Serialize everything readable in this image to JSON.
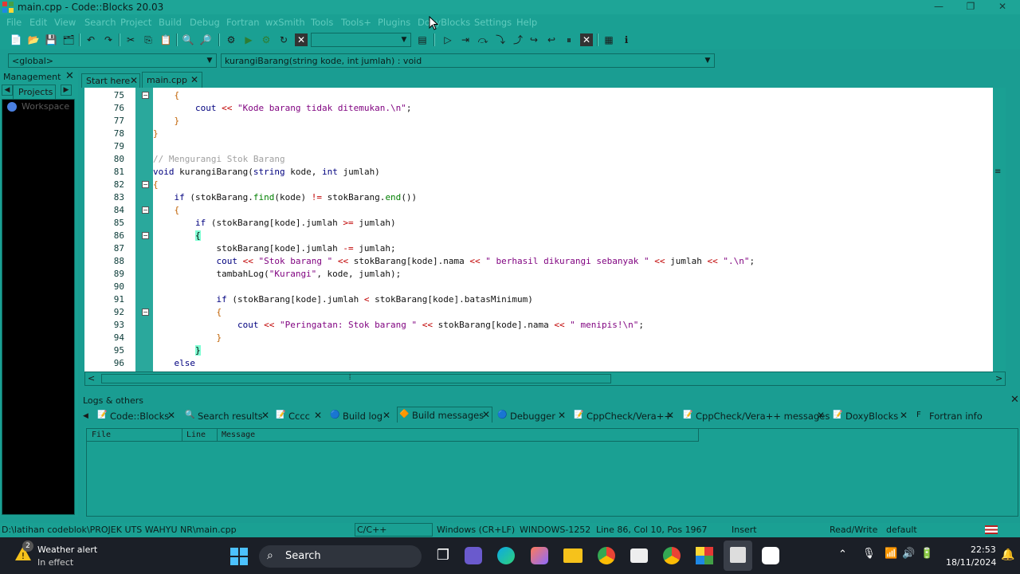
{
  "window": {
    "title": "main.cpp - Code::Blocks 20.03"
  },
  "menu": [
    "File",
    "Edit",
    "View",
    "Search",
    "Project",
    "Build",
    "Debug",
    "Fortran",
    "wxSmith",
    "Tools",
    "Tools+",
    "Plugins",
    "DoxyBlocks",
    "Settings",
    "Help"
  ],
  "toolbar": {
    "scope_value": "<global>",
    "function_value": "kurangiBarang(string kode, int jumlah) : void",
    "target_value": ""
  },
  "management": {
    "title": "Management",
    "tab": "Projects",
    "tree_root": "Workspace"
  },
  "editor_tabs": [
    "Start here",
    "main.cpp"
  ],
  "editor": {
    "line_numbers": [
      "75",
      "76",
      "77",
      "78",
      "79",
      "80",
      "81",
      "82",
      "83",
      "84",
      "85",
      "86",
      "87",
      "88",
      "89",
      "90",
      "91",
      "92",
      "93",
      "94",
      "95",
      "96"
    ]
  },
  "logs": {
    "title": "Logs & others",
    "tabs": [
      "Code::Blocks",
      "Search results",
      "Cccc",
      "Build log",
      "Build messages",
      "Debugger",
      "CppCheck/Vera++",
      "CppCheck/Vera++ messages",
      "DoxyBlocks",
      "Fortran info"
    ],
    "columns": [
      "File",
      "Line",
      "Message"
    ]
  },
  "status": {
    "path": "D:\\latihan codeblok\\PROJEK UTS WAHYU NR\\main.cpp",
    "language": "C/C++",
    "eol": "Windows (CR+LF)",
    "encoding": "WINDOWS-1252",
    "position": "Line 86, Col 10, Pos 1967",
    "mode": "Insert",
    "access": "Read/Write",
    "lexer": "default"
  },
  "taskbar": {
    "weather_title": "Weather alert",
    "weather_sub": "In effect",
    "weather_badge": "2",
    "search_label": "Search",
    "time": "22:53",
    "date": "18/11/2024"
  },
  "colors": {
    "accent": "#1aa093",
    "editor_bg": "#ffffff",
    "taskbar_bg": "#1b1f27"
  }
}
